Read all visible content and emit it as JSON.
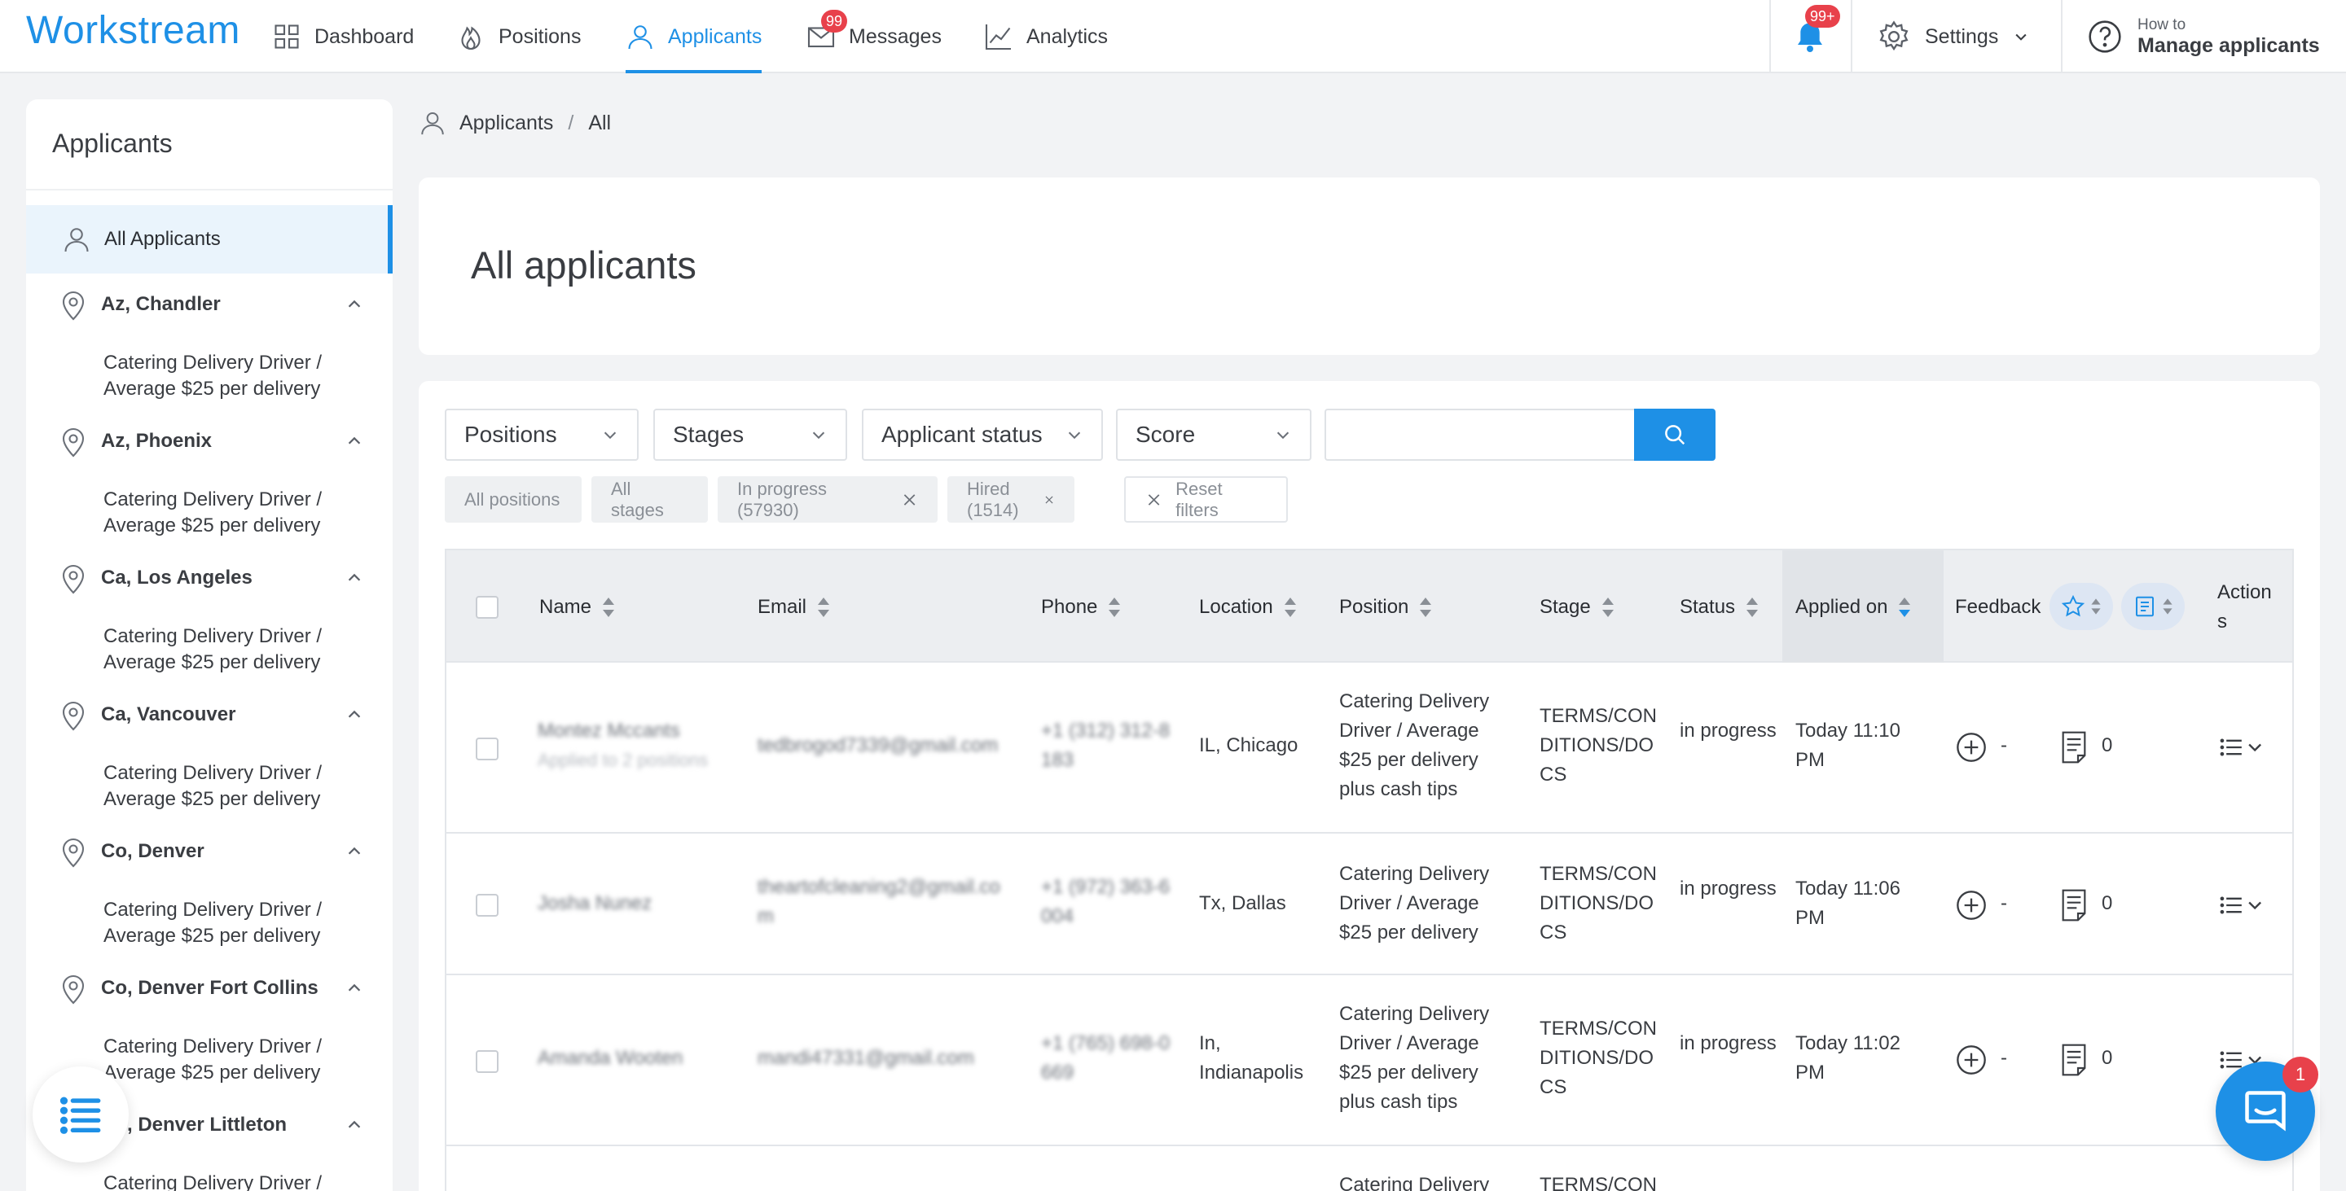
{
  "app": {
    "logo": "Workstream",
    "colors": {
      "accent": "#1e90e6",
      "badge": "#e8414b"
    }
  },
  "nav": {
    "dashboard": "Dashboard",
    "positions": "Positions",
    "applicants": "Applicants",
    "messages": "Messages",
    "messages_badge": "99",
    "analytics": "Analytics",
    "notifications_badge": "99+",
    "settings": "Settings",
    "howto_small": "How to",
    "howto_big": "Manage applicants"
  },
  "sidebar": {
    "title": "Applicants",
    "all_label": "All Applicants",
    "locations": [
      {
        "name": "Az, Chandler",
        "sub1": "Catering Delivery Driver /",
        "sub2": "Average $25 per delivery"
      },
      {
        "name": "Az, Phoenix",
        "sub1": "Catering Delivery Driver /",
        "sub2": "Average $25 per delivery"
      },
      {
        "name": "Ca, Los Angeles",
        "sub1": "Catering Delivery Driver /",
        "sub2": "Average $25 per delivery"
      },
      {
        "name": "Ca, Vancouver",
        "sub1": "Catering Delivery Driver /",
        "sub2": "Average $25 per delivery"
      },
      {
        "name": "Co, Denver",
        "sub1": "Catering Delivery Driver /",
        "sub2": "Average $25 per delivery"
      },
      {
        "name": "Co, Denver Fort Collins",
        "sub1": "Catering Delivery Driver /",
        "sub2": "Average $25 per delivery"
      },
      {
        "name": "Co, Denver Littleton",
        "sub1": "Catering Delivery Driver /",
        "sub2": ""
      }
    ]
  },
  "breadcrumb": {
    "root": "Applicants",
    "separator": "/",
    "current": "All"
  },
  "page_title": "All applicants",
  "filters": {
    "positions": "Positions",
    "stages": "Stages",
    "applicant_status": "Applicant status",
    "score": "Score",
    "search_value": ""
  },
  "chips": {
    "all_positions": "All positions",
    "all_stages": "All stages",
    "in_progress": "In progress (57930)",
    "hired": "Hired (1514)",
    "reset": "Reset filters"
  },
  "table": {
    "headers": {
      "name": "Name",
      "email": "Email",
      "phone": "Phone",
      "location": "Location",
      "position": "Position",
      "stage": "Stage",
      "status": "Status",
      "applied_on": "Applied on",
      "feedback": "Feedback",
      "actions1": "Action",
      "actions2": "s"
    },
    "rows": [
      {
        "name": "Montez Mccants",
        "name_sub": "Applied to 2 positions",
        "email": "tedbrogod7339@gmail.com",
        "phone1": "+1 (312) 312-8",
        "phone2": "183",
        "location1": "IL, Chicago",
        "location2": "",
        "position": [
          "Catering Delivery",
          "Driver / Average",
          "$25 per delivery",
          "plus cash tips"
        ],
        "stage": [
          "TERMS/CON",
          "DITIONS/DO",
          "CS"
        ],
        "status": "in progress",
        "applied1": "Today 11:10",
        "applied2": "PM",
        "feedback_score": "-",
        "notes_count": "0"
      },
      {
        "name": "Josha Nunez",
        "name_sub": "",
        "email1": "theartofcleaning2@gmail.co",
        "email2": "m",
        "phone1": "+1 (972) 363-6",
        "phone2": "004",
        "location1": "Tx, Dallas",
        "location2": "",
        "position": [
          "Catering Delivery",
          "Driver / Average",
          "$25 per delivery",
          ""
        ],
        "stage": [
          "TERMS/CON",
          "DITIONS/DO",
          "CS"
        ],
        "status": "in progress",
        "applied1": "Today 11:06",
        "applied2": "PM",
        "feedback_score": "-",
        "notes_count": "0"
      },
      {
        "name": "Amanda Wooten",
        "name_sub": "",
        "email": "mandi47331@gmail.com",
        "phone1": "+1 (765) 698-0",
        "phone2": "669",
        "location1": "In,",
        "location2": "Indianapolis",
        "position": [
          "Catering Delivery",
          "Driver / Average",
          "$25 per delivery",
          "plus cash tips"
        ],
        "stage": [
          "TERMS/CON",
          "DITIONS/DO",
          "CS"
        ],
        "status": "in progress",
        "applied1": "Today 11:02",
        "applied2": "PM",
        "feedback_score": "-",
        "notes_count": "0"
      },
      {
        "position": [
          "Catering Delivery"
        ],
        "stage": [
          "TERMS/CON"
        ]
      }
    ]
  },
  "chat_badge": "1"
}
